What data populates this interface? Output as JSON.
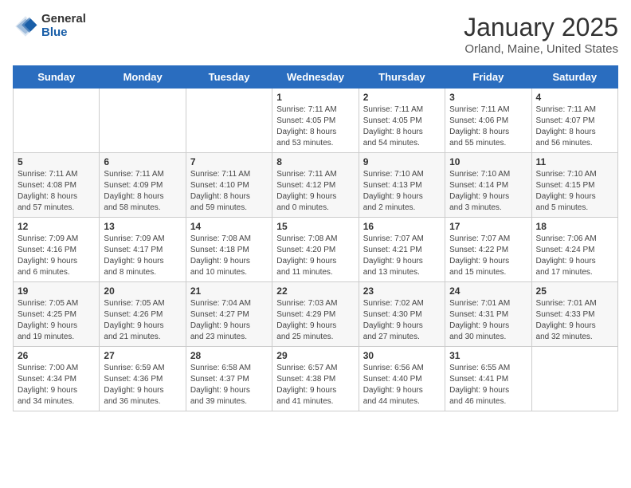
{
  "logo": {
    "general": "General",
    "blue": "Blue"
  },
  "header": {
    "month": "January 2025",
    "location": "Orland, Maine, United States"
  },
  "weekdays": [
    "Sunday",
    "Monday",
    "Tuesday",
    "Wednesday",
    "Thursday",
    "Friday",
    "Saturday"
  ],
  "weeks": [
    [
      {
        "day": "",
        "info": ""
      },
      {
        "day": "",
        "info": ""
      },
      {
        "day": "",
        "info": ""
      },
      {
        "day": "1",
        "info": "Sunrise: 7:11 AM\nSunset: 4:05 PM\nDaylight: 8 hours\nand 53 minutes."
      },
      {
        "day": "2",
        "info": "Sunrise: 7:11 AM\nSunset: 4:05 PM\nDaylight: 8 hours\nand 54 minutes."
      },
      {
        "day": "3",
        "info": "Sunrise: 7:11 AM\nSunset: 4:06 PM\nDaylight: 8 hours\nand 55 minutes."
      },
      {
        "day": "4",
        "info": "Sunrise: 7:11 AM\nSunset: 4:07 PM\nDaylight: 8 hours\nand 56 minutes."
      }
    ],
    [
      {
        "day": "5",
        "info": "Sunrise: 7:11 AM\nSunset: 4:08 PM\nDaylight: 8 hours\nand 57 minutes."
      },
      {
        "day": "6",
        "info": "Sunrise: 7:11 AM\nSunset: 4:09 PM\nDaylight: 8 hours\nand 58 minutes."
      },
      {
        "day": "7",
        "info": "Sunrise: 7:11 AM\nSunset: 4:10 PM\nDaylight: 8 hours\nand 59 minutes."
      },
      {
        "day": "8",
        "info": "Sunrise: 7:11 AM\nSunset: 4:12 PM\nDaylight: 9 hours\nand 0 minutes."
      },
      {
        "day": "9",
        "info": "Sunrise: 7:10 AM\nSunset: 4:13 PM\nDaylight: 9 hours\nand 2 minutes."
      },
      {
        "day": "10",
        "info": "Sunrise: 7:10 AM\nSunset: 4:14 PM\nDaylight: 9 hours\nand 3 minutes."
      },
      {
        "day": "11",
        "info": "Sunrise: 7:10 AM\nSunset: 4:15 PM\nDaylight: 9 hours\nand 5 minutes."
      }
    ],
    [
      {
        "day": "12",
        "info": "Sunrise: 7:09 AM\nSunset: 4:16 PM\nDaylight: 9 hours\nand 6 minutes."
      },
      {
        "day": "13",
        "info": "Sunrise: 7:09 AM\nSunset: 4:17 PM\nDaylight: 9 hours\nand 8 minutes."
      },
      {
        "day": "14",
        "info": "Sunrise: 7:08 AM\nSunset: 4:18 PM\nDaylight: 9 hours\nand 10 minutes."
      },
      {
        "day": "15",
        "info": "Sunrise: 7:08 AM\nSunset: 4:20 PM\nDaylight: 9 hours\nand 11 minutes."
      },
      {
        "day": "16",
        "info": "Sunrise: 7:07 AM\nSunset: 4:21 PM\nDaylight: 9 hours\nand 13 minutes."
      },
      {
        "day": "17",
        "info": "Sunrise: 7:07 AM\nSunset: 4:22 PM\nDaylight: 9 hours\nand 15 minutes."
      },
      {
        "day": "18",
        "info": "Sunrise: 7:06 AM\nSunset: 4:24 PM\nDaylight: 9 hours\nand 17 minutes."
      }
    ],
    [
      {
        "day": "19",
        "info": "Sunrise: 7:05 AM\nSunset: 4:25 PM\nDaylight: 9 hours\nand 19 minutes."
      },
      {
        "day": "20",
        "info": "Sunrise: 7:05 AM\nSunset: 4:26 PM\nDaylight: 9 hours\nand 21 minutes."
      },
      {
        "day": "21",
        "info": "Sunrise: 7:04 AM\nSunset: 4:27 PM\nDaylight: 9 hours\nand 23 minutes."
      },
      {
        "day": "22",
        "info": "Sunrise: 7:03 AM\nSunset: 4:29 PM\nDaylight: 9 hours\nand 25 minutes."
      },
      {
        "day": "23",
        "info": "Sunrise: 7:02 AM\nSunset: 4:30 PM\nDaylight: 9 hours\nand 27 minutes."
      },
      {
        "day": "24",
        "info": "Sunrise: 7:01 AM\nSunset: 4:31 PM\nDaylight: 9 hours\nand 30 minutes."
      },
      {
        "day": "25",
        "info": "Sunrise: 7:01 AM\nSunset: 4:33 PM\nDaylight: 9 hours\nand 32 minutes."
      }
    ],
    [
      {
        "day": "26",
        "info": "Sunrise: 7:00 AM\nSunset: 4:34 PM\nDaylight: 9 hours\nand 34 minutes."
      },
      {
        "day": "27",
        "info": "Sunrise: 6:59 AM\nSunset: 4:36 PM\nDaylight: 9 hours\nand 36 minutes."
      },
      {
        "day": "28",
        "info": "Sunrise: 6:58 AM\nSunset: 4:37 PM\nDaylight: 9 hours\nand 39 minutes."
      },
      {
        "day": "29",
        "info": "Sunrise: 6:57 AM\nSunset: 4:38 PM\nDaylight: 9 hours\nand 41 minutes."
      },
      {
        "day": "30",
        "info": "Sunrise: 6:56 AM\nSunset: 4:40 PM\nDaylight: 9 hours\nand 44 minutes."
      },
      {
        "day": "31",
        "info": "Sunrise: 6:55 AM\nSunset: 4:41 PM\nDaylight: 9 hours\nand 46 minutes."
      },
      {
        "day": "",
        "info": ""
      }
    ]
  ]
}
